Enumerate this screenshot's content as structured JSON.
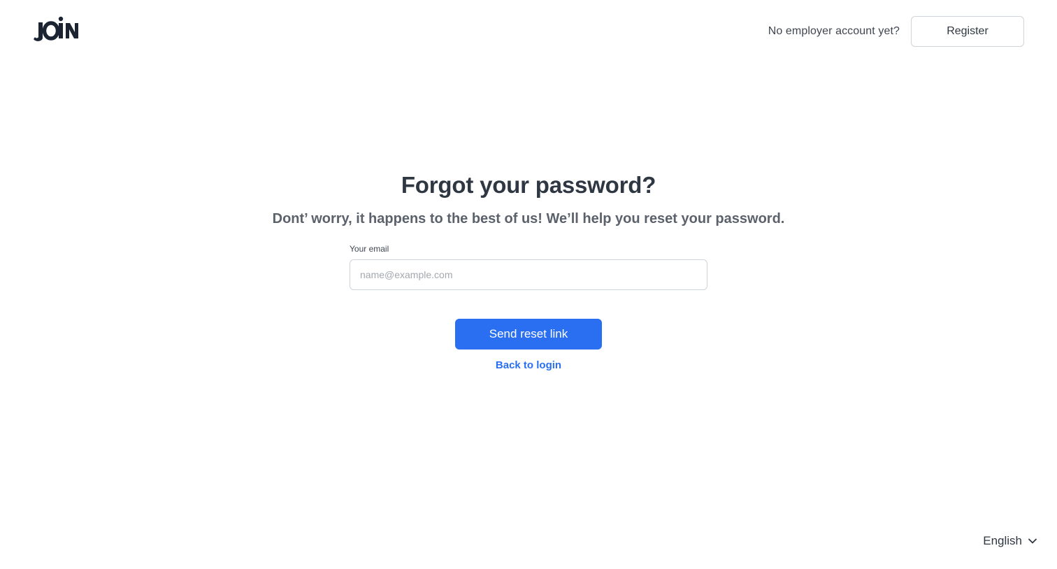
{
  "header": {
    "logo": {
      "icon": "join-logo-icon",
      "text": "JOIN"
    },
    "no_account_text": "No employer account yet?",
    "register_label": "Register"
  },
  "main": {
    "title": "Forgot your password?",
    "subtitle": "Dont’ worry, it happens to the best of us! We’ll help you reset your password.",
    "email_label": "Your email",
    "email_value": "",
    "email_placeholder": "name@example.com",
    "send_label": "Send reset link",
    "back_label": "Back to login"
  },
  "footer": {
    "language": "English",
    "language_icon": "chevron-down-icon"
  },
  "colors": {
    "accent": "#2a6ff2",
    "text": "#2f3742",
    "border": "#cfd4da"
  }
}
